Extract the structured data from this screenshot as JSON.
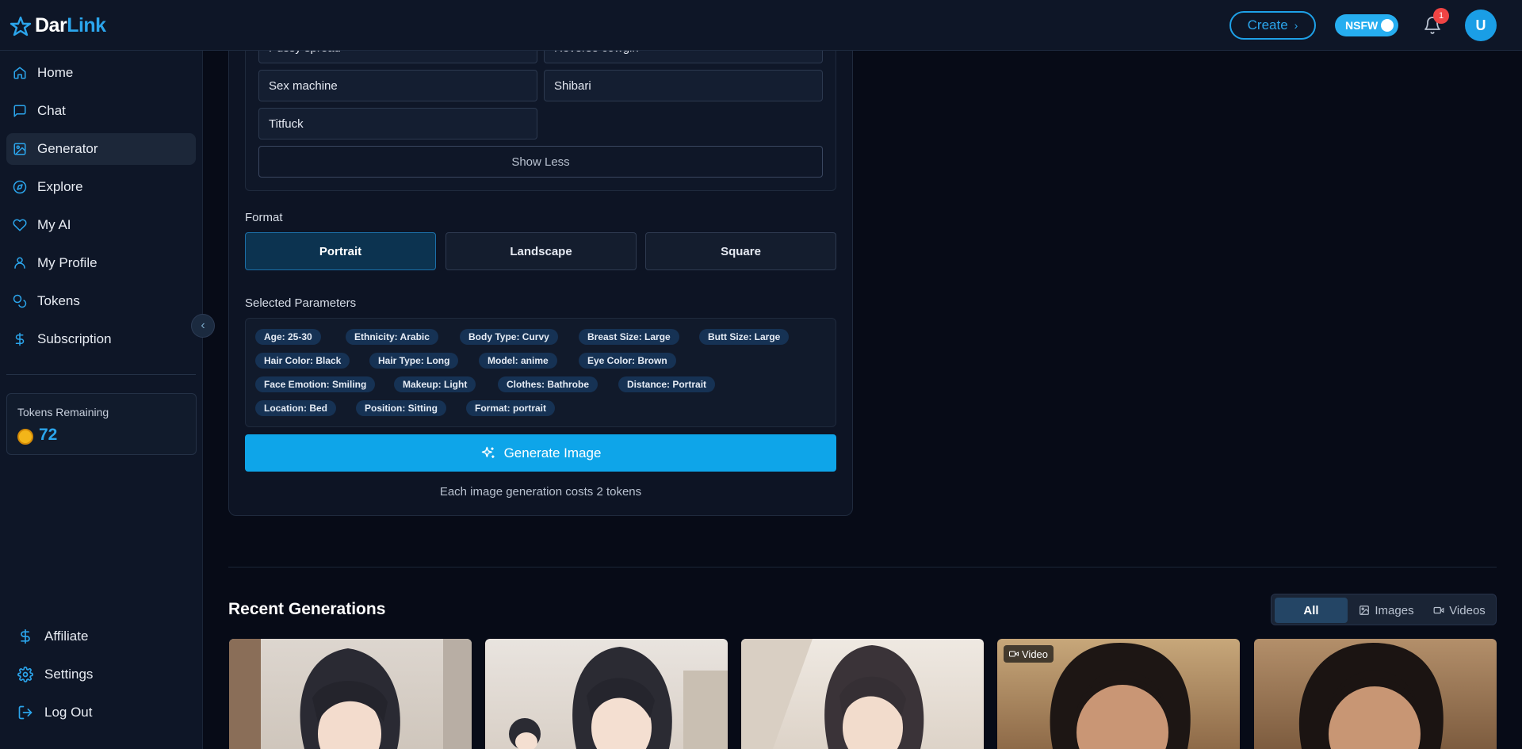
{
  "brand": {
    "name_part1": "Dar",
    "name_part2": "Link"
  },
  "topbar": {
    "create_label": "Create",
    "nsfw_label": "NSFW",
    "notification_count": "1",
    "avatar_initial": "U"
  },
  "sidebar": {
    "items": [
      {
        "label": "Home",
        "icon": "home-icon"
      },
      {
        "label": "Chat",
        "icon": "chat-icon"
      },
      {
        "label": "Generator",
        "icon": "image-icon",
        "active": true
      },
      {
        "label": "Explore",
        "icon": "compass-icon"
      },
      {
        "label": "My AI",
        "icon": "heart-icon"
      },
      {
        "label": "My Profile",
        "icon": "user-icon"
      },
      {
        "label": "Tokens",
        "icon": "coins-icon"
      },
      {
        "label": "Subscription",
        "icon": "dollar-icon"
      }
    ],
    "tokens_label": "Tokens Remaining",
    "tokens_value": "72",
    "bottom": [
      {
        "label": "Affiliate",
        "icon": "dollar-icon"
      },
      {
        "label": "Settings",
        "icon": "gear-icon"
      },
      {
        "label": "Log Out",
        "icon": "logout-icon"
      }
    ]
  },
  "generator": {
    "poses": [
      "Pussy spread",
      "Reverse cowgirl",
      "Sex machine",
      "Shibari",
      "Titfuck"
    ],
    "show_less_label": "Show Less",
    "format_label": "Format",
    "formats": [
      "Portrait",
      "Landscape",
      "Square"
    ],
    "selected_format": "Portrait",
    "params_label": "Selected Parameters",
    "params": [
      "Age: 25-30",
      "Ethnicity: Arabic",
      "Body Type: Curvy",
      "Breast Size: Large",
      "Butt Size: Large",
      "Hair Color: Black",
      "Hair Type: Long",
      "Model: anime",
      "Eye Color: Brown",
      "Face Emotion: Smiling",
      "Makeup: Light",
      "Clothes: Bathrobe",
      "Distance: Portrait",
      "Location: Bed",
      "Position: Sitting",
      "Format: portrait"
    ],
    "generate_label": "Generate Image",
    "cost_note": "Each image generation costs 2 tokens"
  },
  "recent": {
    "title": "Recent Generations",
    "filters": [
      "All",
      "Images",
      "Videos"
    ],
    "active_filter": "All",
    "video_badge": "Video"
  },
  "colors": {
    "accent": "#0ea5e9",
    "background": "#070b17",
    "panel": "#0e1627",
    "badge": "#ef4444"
  }
}
